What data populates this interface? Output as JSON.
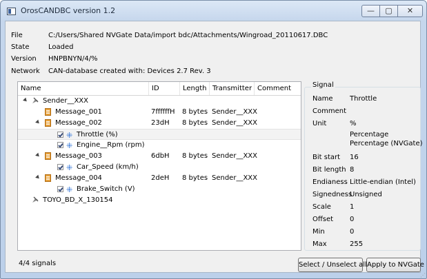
{
  "window": {
    "title": "OrosCANDBC version 1.2",
    "controls": {
      "min": "—",
      "max": "▢",
      "close": "✕"
    }
  },
  "info": [
    {
      "label": "File",
      "value": "C:/Users/Shared NVGate Data/import bdc/Attachments/Wingroad_20110617.DBC"
    },
    {
      "label": "State",
      "value": "Loaded"
    },
    {
      "label": "Version",
      "value": "HNPBNYN/4/%"
    },
    {
      "label": "Network",
      "value": "CAN-database created with: Devices 2.7 Rev. 3"
    }
  ],
  "tree": {
    "columns": [
      "Name",
      "ID",
      "Length",
      "Transmitter",
      "Comment"
    ],
    "rows": [
      {
        "kind": "sender",
        "name": "Sender__XXX",
        "id": "",
        "length": "",
        "transmitter": "",
        "expanded": true
      },
      {
        "kind": "message",
        "name": "Message_001",
        "id": "7ffffffH",
        "length": "8 bytes",
        "transmitter": "Sender__XXX",
        "expanded": false
      },
      {
        "kind": "message",
        "name": "Message_002",
        "id": "23dH",
        "length": "8 bytes",
        "transmitter": "Sender__XXX",
        "expanded": true
      },
      {
        "kind": "signal",
        "name": "Throttle (%)",
        "id": "",
        "length": "",
        "transmitter": "",
        "checked": true,
        "selected": true
      },
      {
        "kind": "signal",
        "name": "Engine__Rpm (rpm)",
        "id": "",
        "length": "",
        "transmitter": "",
        "checked": true
      },
      {
        "kind": "message",
        "name": "Message_003",
        "id": "6dbH",
        "length": "8 bytes",
        "transmitter": "Sender__XXX",
        "expanded": true
      },
      {
        "kind": "signal",
        "name": "Car_Speed (km/h)",
        "id": "",
        "length": "",
        "transmitter": "",
        "checked": true
      },
      {
        "kind": "message",
        "name": "Message_004",
        "id": "2deH",
        "length": "8 bytes",
        "transmitter": "Sender__XXX",
        "expanded": true
      },
      {
        "kind": "signal",
        "name": "Brake_Switch (V)",
        "id": "",
        "length": "",
        "transmitter": "",
        "checked": true
      },
      {
        "kind": "sender",
        "name": "TOYO_BD_X_130154",
        "id": "",
        "length": "",
        "transmitter": "",
        "expanded": false
      }
    ]
  },
  "signal": {
    "title": "Signal",
    "fields": [
      {
        "label": "Name",
        "value": "Throttle"
      },
      {
        "label": "Comment",
        "value": ""
      },
      {
        "label": "Unit",
        "value": "%"
      },
      {
        "label": "",
        "value": "Percentage"
      },
      {
        "label": "",
        "value": "Percentage (NVGate)"
      },
      {
        "label": "Bit start",
        "value": "16"
      },
      {
        "label": "Bit length",
        "value": "8"
      },
      {
        "label": "Endianess",
        "value": "Little-endian (Intel)"
      },
      {
        "label": "Signedness",
        "value": "Unsigned"
      },
      {
        "label": "Scale",
        "value": "1"
      },
      {
        "label": "Offset",
        "value": "0"
      },
      {
        "label": "Min",
        "value": "0"
      },
      {
        "label": "Max",
        "value": "255"
      }
    ]
  },
  "footer": {
    "status": "4/4 signals",
    "select_label": "Select / Unselect all",
    "apply_label": "Apply to NVGate"
  },
  "colors": {
    "accent": "#2a6fd6",
    "message_icon": "#e8a23c"
  }
}
